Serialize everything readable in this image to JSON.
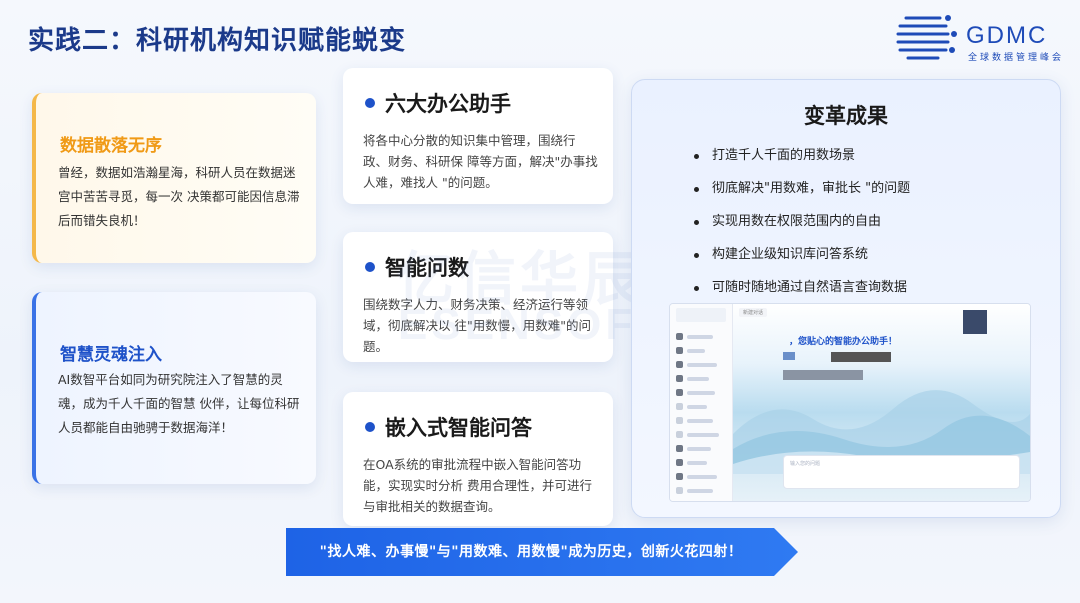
{
  "page": {
    "title": "实践二：科研机构知识赋能蜕变"
  },
  "logo": {
    "brand": "GDMC",
    "sub": "全球数据管理峰会"
  },
  "left_cards": [
    {
      "heading": "数据散落无序",
      "body": "曾经，数据如浩瀚星海，科研人员在数据迷宫中苦苦寻觅，每一次 决策都可能因信息滞后而错失良机！"
    },
    {
      "heading": "智慧灵魂注入",
      "body": "AI数智平台如同为研究院注入了智慧的灵魂，成为千人千面的智慧 伙伴，让每位科研人员都能自由驰骋于数据海洋！"
    }
  ],
  "mid_cards": [
    {
      "heading": "六大办公助手",
      "body": "将各中心分散的知识集中管理，围绕行政、财务、科研保 障等方面，解决\"办事找人难，难找人 \"的问题。"
    },
    {
      "heading": "智能问数",
      "body": "围绕数字人力、财务决策、经济运行等领域，彻底解决以 往\"用数慢，用数难\"的问题。"
    },
    {
      "heading": "嵌入式智能问答",
      "body": "在OA系统的审批流程中嵌入智能问答功能，实现实时分析 费用合理性，并可进行与审批相关的数据查询。"
    }
  ],
  "watermark": {
    "line1": "亿信华辰",
    "line2": "ESENSOFT"
  },
  "results": {
    "heading": "变革成果",
    "items": [
      "打造千人千面的用数场景",
      "彻底解决\"用数难，审批长 \"的问题",
      "实现用数在权限范围内的自由",
      "构建企业级知识库问答系统",
      "可随时随地通过自然语言查询数据"
    ]
  },
  "screenshot": {
    "greeting": "，您贴心的智能办公助手！",
    "input_placeholder": "输入您的问题",
    "tab_label": "新建对话"
  },
  "banner": {
    "text": "\"找人难、办事慢\"与\"用数难、用数慢\"成为历史，创新火花四射！"
  },
  "colors": {
    "primary": "#1e52c9",
    "accent_orange": "#f09a16",
    "dark_text": "#1a1a1a"
  }
}
